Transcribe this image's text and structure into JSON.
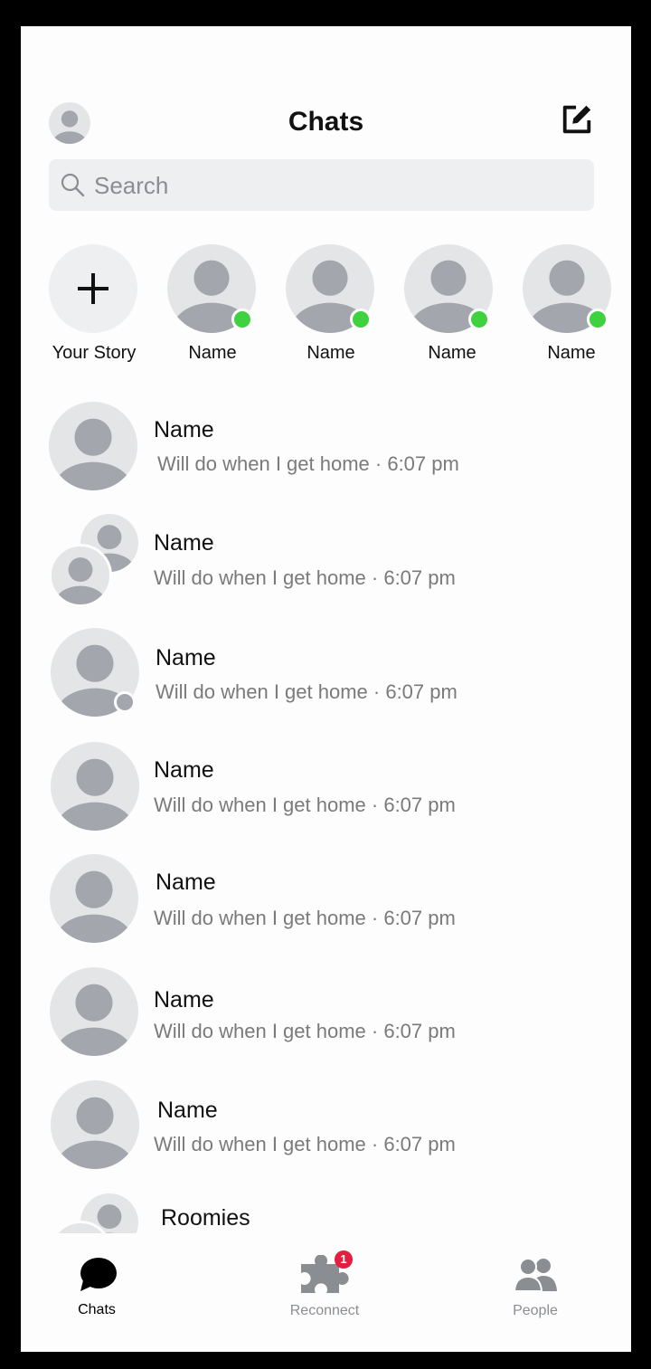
{
  "header": {
    "title": "Chats"
  },
  "search": {
    "placeholder": "Search"
  },
  "stories": [
    {
      "label": "Your Story"
    },
    {
      "label": "Name"
    },
    {
      "label": "Name"
    },
    {
      "label": "Name"
    },
    {
      "label": "Name"
    }
  ],
  "chats": [
    {
      "name": "Name",
      "preview": "Will do when I get home · 6:07 pm"
    },
    {
      "name": "Name",
      "preview": "Will do when I get home · 6:07 pm"
    },
    {
      "name": "Name",
      "preview": "Will do when I get home · 6:07 pm"
    },
    {
      "name": "Name",
      "preview": "Will do when I get home · 6:07 pm"
    },
    {
      "name": "Name",
      "preview": "Will do when I get home · 6:07 pm"
    },
    {
      "name": "Name",
      "preview": "Will do when I get home · 6:07 pm"
    },
    {
      "name": "Name",
      "preview": "Will do when I get home · 6:07 pm"
    },
    {
      "name": "Roomies"
    }
  ],
  "tabs": {
    "chats": "Chats",
    "reconnect": "Reconnect",
    "reconnect_badge": "1",
    "people": "People"
  },
  "colors": {
    "online": "#3fd13f",
    "badge": "#e41e3f",
    "avatar_bg": "#e4e5e7",
    "avatar_fg": "#a3a7ad",
    "active_tab": "#000000",
    "inactive_tab": "#8a8d91"
  },
  "icons": [
    "profile-avatar-icon",
    "compose-icon",
    "search-icon",
    "plus-icon",
    "chat-bubble-icon",
    "puzzle-icon",
    "people-icon"
  ]
}
